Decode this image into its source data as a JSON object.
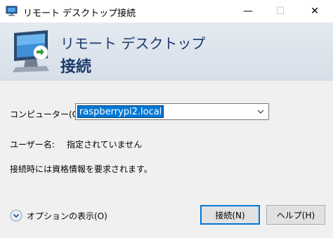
{
  "window": {
    "title": "リモート デスクトップ接続",
    "minimize_glyph": "—",
    "maximize_glyph": "☐",
    "close_glyph": "✕"
  },
  "banner": {
    "line1": "リモート デスクトップ",
    "line2": "接続",
    "icon": "remote-desktop-monitor-icon"
  },
  "form": {
    "computer_label": "コンピューター(C):",
    "computer_value": "raspberrypi2.local",
    "username_label": "ユーザー名:",
    "username_value": "指定されていません",
    "info_text": "接続時には資格情報を要求されます。"
  },
  "footer": {
    "options_label": "オプションの表示(O)",
    "connect_button": "接続(N)",
    "help_button": "ヘルプ(H)"
  },
  "colors": {
    "accent": "#0078d7",
    "banner_text": "#1a3a6b"
  }
}
